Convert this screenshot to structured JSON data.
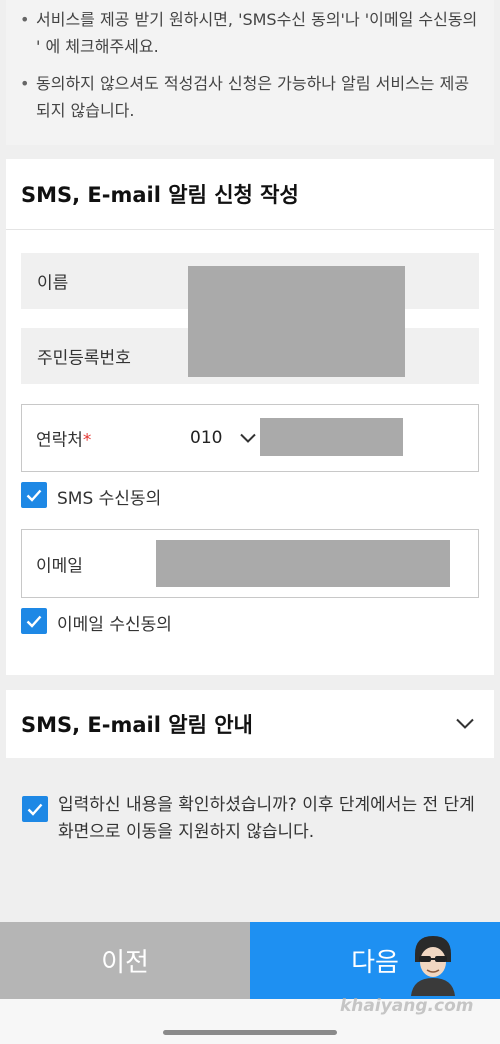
{
  "notice": {
    "items": [
      "서비스를 제공 받기 원하시면, 'SMS수신 동의'나 '이메일 수신동의 ' 에 체크해주세요.",
      "동의하지 않으셔도 적성검사 신청은 가능하나 알림 서비스는 제공되지 않습니다."
    ]
  },
  "form": {
    "title": "SMS, E-mail 알림 신청 작성",
    "name_label": "이름",
    "rrn_label": "주민등록번호",
    "phone_label": "연락처",
    "required_mark": "*",
    "phone_prefix": "010",
    "sms_consent_label": "SMS 수신동의",
    "sms_consent_checked": true,
    "email_label": "이메일",
    "email_consent_label": "이메일 수신동의",
    "email_consent_checked": true
  },
  "info": {
    "title": "SMS, E-mail 알림 안내"
  },
  "confirm": {
    "text": "입력하신 내용을 확인하셨습니까? 이후 단계에서는 전 단계화면으로 이동을 지원하지 않습니다.",
    "checked": true
  },
  "buttons": {
    "prev": "이전",
    "next": "다음"
  },
  "watermark": "khaiyang.com",
  "colors": {
    "accent": "#1e90f2",
    "checkbox": "#1e88e5",
    "disabled_button": "#b5b5b5",
    "required": "#e53935"
  }
}
